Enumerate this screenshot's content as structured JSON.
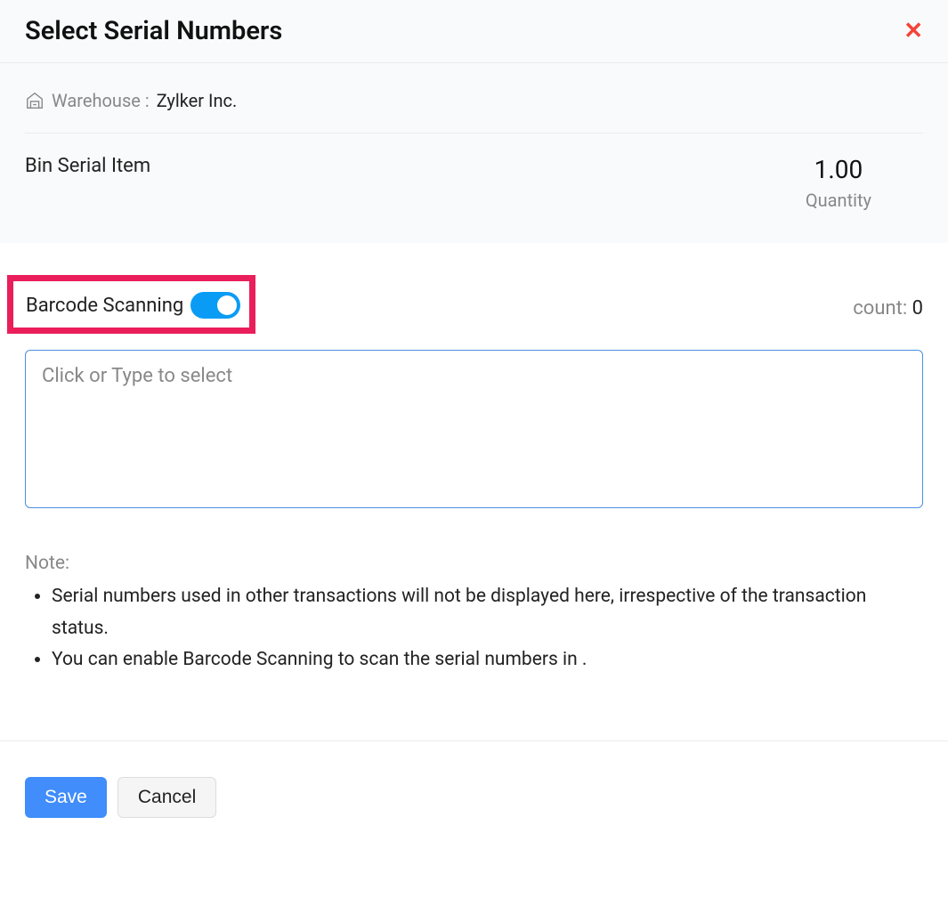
{
  "header": {
    "title": "Select Serial Numbers",
    "close_icon": "close-icon"
  },
  "warehouse": {
    "label": "Warehouse :",
    "name": "Zylker Inc."
  },
  "item": {
    "name": "Bin Serial Item",
    "quantity_value": "1.00",
    "quantity_label": "Quantity"
  },
  "barcode": {
    "label": "Barcode Scanning",
    "enabled": true
  },
  "count": {
    "label": "count:",
    "value": "0"
  },
  "select_area": {
    "placeholder": "Click or Type to select"
  },
  "note": {
    "heading": "Note:",
    "items": [
      "Serial numbers used in other transactions will not be displayed here, irrespective of the transaction status.",
      "You can enable Barcode Scanning to scan the serial numbers in ."
    ]
  },
  "footer": {
    "save_label": "Save",
    "cancel_label": "Cancel"
  }
}
